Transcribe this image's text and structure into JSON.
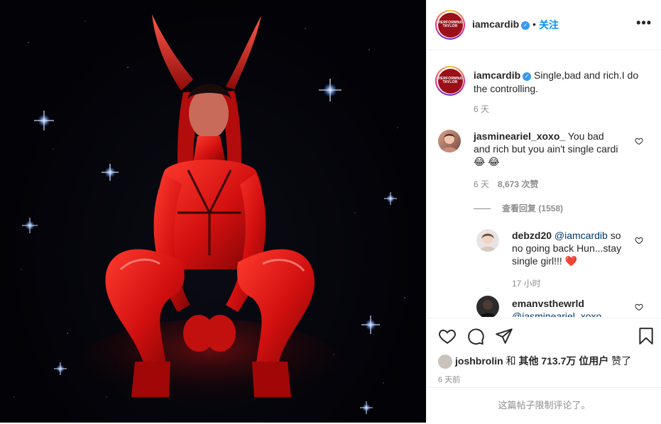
{
  "post": {
    "image_alt": "Performer in red latex outfit with devil horns crouching against starry night background"
  },
  "header": {
    "username": "iamcardib",
    "verified_glyph": "✓",
    "dot": "•",
    "follow_label": "关注",
    "more_label": "•••",
    "logo_line1": "HERFORMNA",
    "logo_line2": "TAYLOR"
  },
  "caption": {
    "username": "iamcardib",
    "text": "Single,bad and rich.I do the controlling.",
    "time": "6 天"
  },
  "comments": [
    {
      "username": "jasmineariel_xoxo_",
      "text": "You bad and rich but you ain't single cardi 😂 😂",
      "time": "6 天",
      "likes": "8,673 次赞",
      "view_replies": "查看回复 (1558)",
      "replies": [
        {
          "username": "debzd20",
          "mention": "@iamcardib",
          "text": "so no going back Hun...stay single girl!!! ❤️",
          "time": "17 小时"
        },
        {
          "username": "emanvsthewrld",
          "mention": "@jasmineariel_xoxo_",
          "text": ""
        }
      ]
    }
  ],
  "footer": {
    "liked_by_user": "joshbrolin",
    "liked_and": "和",
    "liked_others": "其他 713.7万 位用户",
    "liked_suffix": "赞了",
    "post_time": "6 天前",
    "comments_limited": "这篇帖子限制评论了。"
  },
  "icons": {
    "like": "heart-icon",
    "comment": "comment-icon",
    "share": "paper-plane-icon",
    "save": "bookmark-icon",
    "verified": "verified-badge-icon"
  },
  "colors": {
    "accent_blue": "#0095f6",
    "verified_blue": "#3897f0",
    "muted": "#8e8e8e",
    "text": "#262626",
    "logo_red": "#9b1018"
  }
}
